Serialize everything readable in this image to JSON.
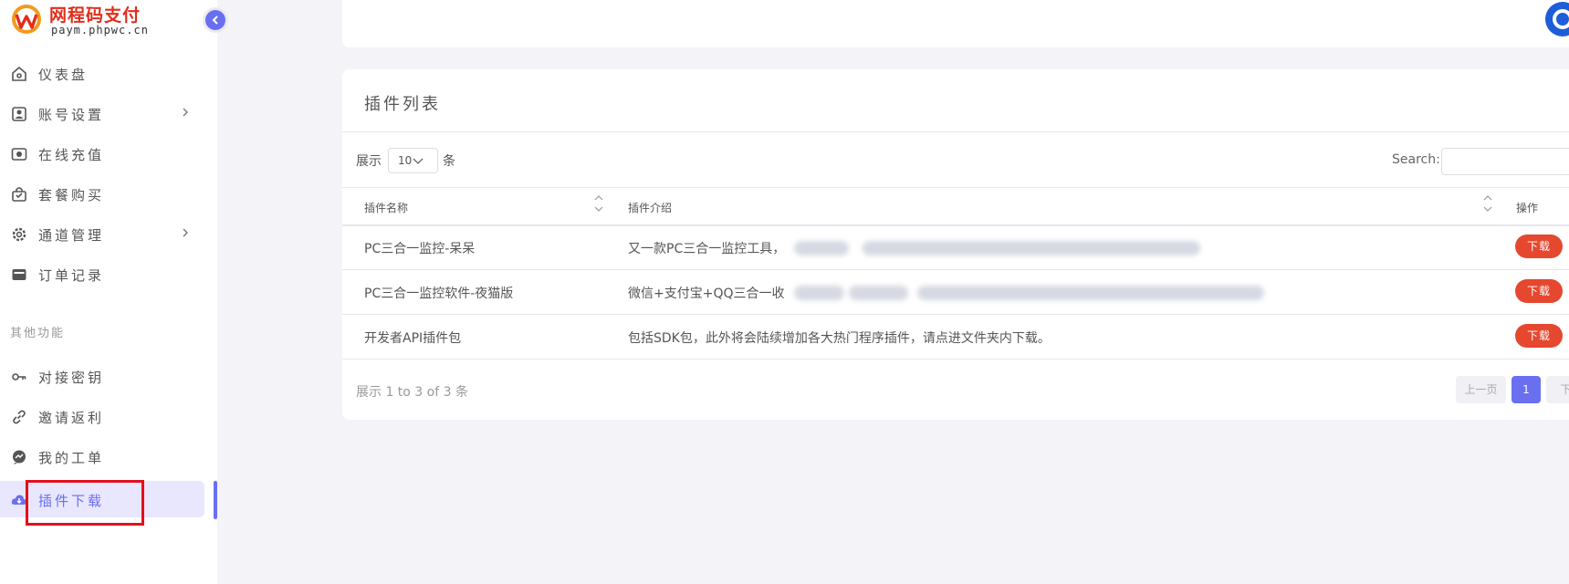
{
  "brand": {
    "name": "网程码支付",
    "domain": "paym.phpwc.cn"
  },
  "sidebar": {
    "items": [
      {
        "label": "仪表盘",
        "icon": "home-icon"
      },
      {
        "label": "账号设置",
        "icon": "user-card-icon",
        "has_submenu": true
      },
      {
        "label": "在线充值",
        "icon": "wallet-icon"
      },
      {
        "label": "套餐购买",
        "icon": "shopping-bag-icon"
      },
      {
        "label": "通道管理",
        "icon": "gear-icon",
        "has_submenu": true
      },
      {
        "label": "订单记录",
        "icon": "order-card-icon"
      }
    ],
    "section_title": "其他功能",
    "other_items": [
      {
        "label": "对接密钥",
        "icon": "key-icon"
      },
      {
        "label": "邀请返利",
        "icon": "link-icon"
      },
      {
        "label": "我的工单",
        "icon": "message-icon"
      },
      {
        "label": "插件下载",
        "icon": "cloud-download-icon",
        "active": true
      }
    ]
  },
  "card": {
    "title": "插件列表",
    "length": {
      "prefix": "展示",
      "value": "10",
      "suffix": "条"
    },
    "search_label": "Search:",
    "columns": [
      "插件名称",
      "插件介绍",
      "操作"
    ],
    "rows": [
      {
        "name": "PC三合一监控-呆呆",
        "desc": "又一款PC三合一监控工具，",
        "action": "下载"
      },
      {
        "name": "PC三合一监控软件-夜猫版",
        "desc": "微信+支付宝+QQ三合一收",
        "action": "下载"
      },
      {
        "name": "开发者API插件包",
        "desc": "包括SDK包，此外将会陆续增加各大热门程序插件，请点进文件夹内下载。",
        "action": "下载"
      }
    ],
    "info": "展示 1 to 3 of 3 条",
    "pagination": {
      "prev": "上一页",
      "current": "1",
      "next": "下一"
    }
  },
  "colors": {
    "accent": "#6a6ff0",
    "brand_red": "#e02e1b",
    "download_button": "#e5472f",
    "highlight_box": "#e3101b"
  }
}
